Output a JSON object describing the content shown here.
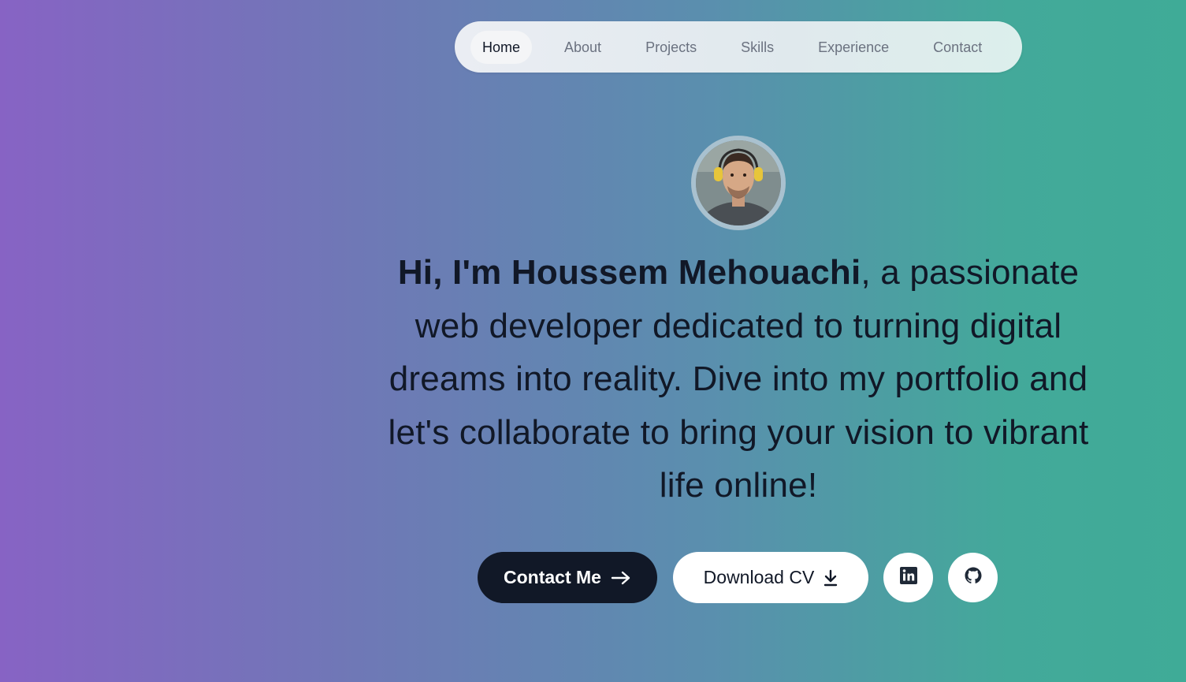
{
  "nav": {
    "items": [
      {
        "label": "Home",
        "active": true
      },
      {
        "label": "About"
      },
      {
        "label": "Projects"
      },
      {
        "label": "Skills"
      },
      {
        "label": "Experience"
      },
      {
        "label": "Contact"
      }
    ]
  },
  "hero": {
    "greeting": "Hi, I'm Houssem Mehouachi",
    "tagline": ", a passionate web developer dedicated to turning digital dreams into reality. Dive into my portfolio and let's collaborate to bring your vision to vibrant life online!"
  },
  "buttons": {
    "contact_label": "Contact Me",
    "cv_label": "Download CV",
    "linkedin_icon": "linkedin-icon",
    "github_icon": "github-icon"
  },
  "colors": {
    "gradient_start": "#8763c4",
    "gradient_end": "#3fab97",
    "dark_button": "#111827",
    "text": "#111827"
  }
}
